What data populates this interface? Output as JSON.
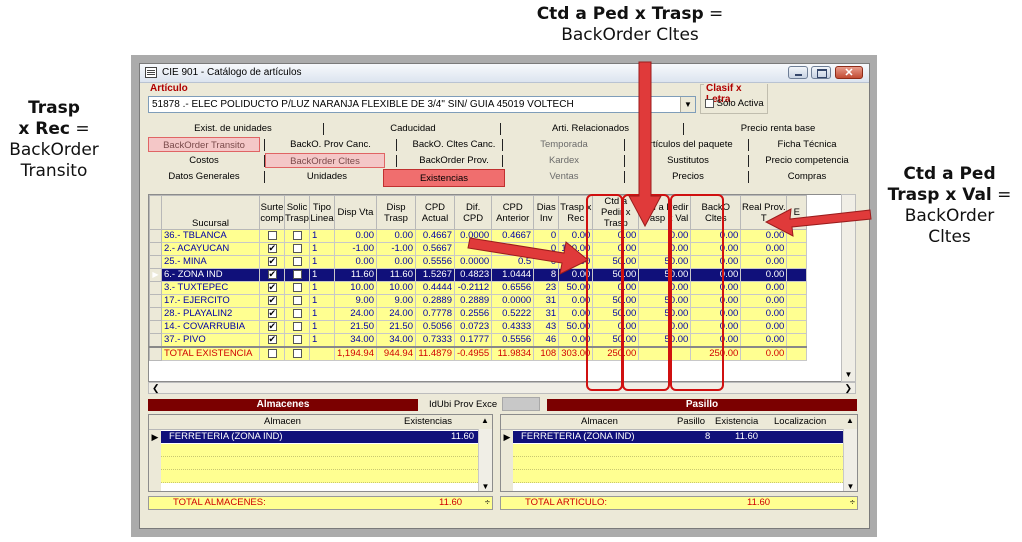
{
  "annotations": {
    "top_title": "Ctd a Ped x Trasp",
    "top_eq": "=",
    "top_sub": "BackOrder Cltes",
    "left_l1": "Trasp",
    "left_l2": "x Rec",
    "left_eq": "=",
    "left_l3": "BackOrder",
    "left_l4": "Transito",
    "right_l1": "Ctd a Ped",
    "right_l2": "Trasp x Val",
    "right_eq": "=",
    "right_l3": "BackOrder",
    "right_l4": "Cltes"
  },
  "window": {
    "title": "CIE 901 - Catálogo de artículos",
    "close_glyph": "✕"
  },
  "articulo": {
    "label": "Artículo",
    "value": "51878 .- ELEC POLIDUCTO P/LUZ NARANJA FLEXIBLE DE 3/4\" SIN/ GUIA 45019 VOLTECH",
    "drop_glyph": "▼"
  },
  "clasif": {
    "label": "Clasif x Letra",
    "checkbox_label": "Solo Activa"
  },
  "tabs": {
    "row1": [
      "Exist. de unidades",
      "Caducidad",
      "Arti. Relacionados",
      "Precio renta base"
    ],
    "row2": [
      "BackOrder Transito",
      "BackO. Prov Canc.",
      "BackO. Cltes Canc.",
      "Temporada",
      "Artículos del paquete",
      "Ficha Técnica"
    ],
    "row3": [
      "Costos",
      "BackOrder Cltes",
      "BackOrder Prov.",
      "Kardex",
      "Sustitutos",
      "Precio competencia"
    ],
    "row4": [
      "Datos Generales",
      "Unidades",
      "Existencias",
      "Ventas",
      "Precios",
      "Compras"
    ]
  },
  "grid": {
    "headers": [
      "Sucursal",
      "Surte comp",
      "Solic Trasp",
      "Tipo Linea",
      "Disp Vta",
      "Disp Trasp",
      "CPD Actual",
      "Dif. CPD",
      "CPD Anterior",
      "Dias Inv",
      "Trasp x Rec",
      "Ctd a Pedir x Trasp",
      "Ctd a Pedir Trasp x Val",
      "BackO Cltes",
      "Real Prov. T",
      "E"
    ],
    "rows": [
      {
        "sucursal": "36.- TBLANCA",
        "surte": false,
        "solic": false,
        "tipo": "1",
        "disp_vta": "0.00",
        "disp_trasp": "0.00",
        "cpd_actual": "0.4667",
        "dif_cpd": "0.0000",
        "cpd_ant": "0.4667",
        "dias": "0",
        "trasp_rec": "0.00",
        "ctd_trasp": "0.00",
        "ctd_val": "0.00",
        "backo": "0.00",
        "real_prov": "0.00"
      },
      {
        "sucursal": "2.- ACAYUCAN",
        "surte": true,
        "solic": false,
        "tipo": "1",
        "disp_vta": "-1.00",
        "disp_trasp": "-1.00",
        "cpd_actual": "0.5667",
        "dif_cpd": "",
        "cpd_ant": "",
        "dias": "0",
        "trasp_rec": "100.00",
        "ctd_trasp": "0.00",
        "ctd_val": "0.00",
        "backo": "0.00",
        "real_prov": "0.00"
      },
      {
        "sucursal": "25.- MINA",
        "surte": true,
        "solic": false,
        "tipo": "1",
        "disp_vta": "0.00",
        "disp_trasp": "0.00",
        "cpd_actual": "0.5556",
        "dif_cpd": "0.0000",
        "cpd_ant": "0.5",
        "dias": "0",
        "trasp_rec": "50.00",
        "ctd_trasp": "50.00",
        "ctd_val": "50.00",
        "backo": "0.00",
        "real_prov": "0.00"
      },
      {
        "sucursal": "6.- ZONA IND",
        "surte": true,
        "solic": false,
        "tipo": "1",
        "disp_vta": "11.60",
        "disp_trasp": "11.60",
        "cpd_actual": "1.5267",
        "dif_cpd": "0.4823",
        "cpd_ant": "1.0444",
        "dias": "8",
        "trasp_rec": "0.00",
        "ctd_trasp": "50.00",
        "ctd_val": "50.00",
        "backo": "0.00",
        "real_prov": "0.00",
        "selected": true
      },
      {
        "sucursal": "3.- TUXTEPEC",
        "surte": true,
        "solic": false,
        "tipo": "1",
        "disp_vta": "10.00",
        "disp_trasp": "10.00",
        "cpd_actual": "0.4444",
        "dif_cpd": "-0.2112",
        "cpd_ant": "0.6556",
        "dias": "23",
        "trasp_rec": "50.00",
        "ctd_trasp": "0.00",
        "ctd_val": "0.00",
        "backo": "0.00",
        "real_prov": "0.00"
      },
      {
        "sucursal": "17.- EJERCITO",
        "surte": true,
        "solic": false,
        "tipo": "1",
        "disp_vta": "9.00",
        "disp_trasp": "9.00",
        "cpd_actual": "0.2889",
        "dif_cpd": "0.2889",
        "cpd_ant": "0.0000",
        "dias": "31",
        "trasp_rec": "0.00",
        "ctd_trasp": "50.00",
        "ctd_val": "50.00",
        "backo": "0.00",
        "real_prov": "0.00"
      },
      {
        "sucursal": "28.- PLAYALIN2",
        "surte": true,
        "solic": false,
        "tipo": "1",
        "disp_vta": "24.00",
        "disp_trasp": "24.00",
        "cpd_actual": "0.7778",
        "dif_cpd": "0.2556",
        "cpd_ant": "0.5222",
        "dias": "31",
        "trasp_rec": "0.00",
        "ctd_trasp": "50.00",
        "ctd_val": "50.00",
        "backo": "0.00",
        "real_prov": "0.00"
      },
      {
        "sucursal": "14.- COVARRUBIA",
        "surte": true,
        "solic": false,
        "tipo": "1",
        "disp_vta": "21.50",
        "disp_trasp": "21.50",
        "cpd_actual": "0.5056",
        "dif_cpd": "0.0723",
        "cpd_ant": "0.4333",
        "dias": "43",
        "trasp_rec": "50.00",
        "ctd_trasp": "0.00",
        "ctd_val": "0.00",
        "backo": "0.00",
        "real_prov": "0.00"
      },
      {
        "sucursal": "37.- PIVO",
        "surte": true,
        "solic": false,
        "tipo": "1",
        "disp_vta": "34.00",
        "disp_trasp": "34.00",
        "cpd_actual": "0.7333",
        "dif_cpd": "0.1777",
        "cpd_ant": "0.5556",
        "dias": "46",
        "trasp_rec": "0.00",
        "ctd_trasp": "50.00",
        "ctd_val": "50.00",
        "backo": "0.00",
        "real_prov": "0.00"
      }
    ],
    "total": {
      "sucursal": "TOTAL EXISTENCIA",
      "disp_vta": "1,194.94",
      "disp_trasp": "944.94",
      "cpd_actual": "11.4879",
      "dif_cpd": "-0.4955",
      "cpd_ant": "11.9834",
      "dias": "108",
      "trasp_rec": "303.00",
      "ctd_trasp": "250.00",
      "ctd_val": "",
      "backo": "250.00",
      "real_prov": "0.00"
    }
  },
  "section_bars": {
    "almacenes": "Almacenes",
    "idubi": "IdUbi Prov Exce",
    "pasillo": "Pasillo"
  },
  "almacenes": {
    "headers": [
      "Almacen",
      "Existencias"
    ],
    "rows": [
      {
        "almacen": "FERRETERIA (ZONA IND)",
        "existencias": "11.60"
      }
    ],
    "total_label": "TOTAL ALMACENES:",
    "total_value": "11.60"
  },
  "pasillo": {
    "headers": [
      "Almacen",
      "Pasillo",
      "Existencia",
      "Localizacion"
    ],
    "rows": [
      {
        "almacen": "FERRETERIA (ZONA IND)",
        "pasillo": "8",
        "existencia": "11.60",
        "localizacion": ""
      }
    ],
    "total_label": "TOTAL ARTICULO:",
    "total_value": "11.60"
  },
  "colors": {
    "grid_row": "#FFFF91",
    "selected_row": "#10107A",
    "highlight_red": "#D01010",
    "section_bar": "#7B0000"
  }
}
